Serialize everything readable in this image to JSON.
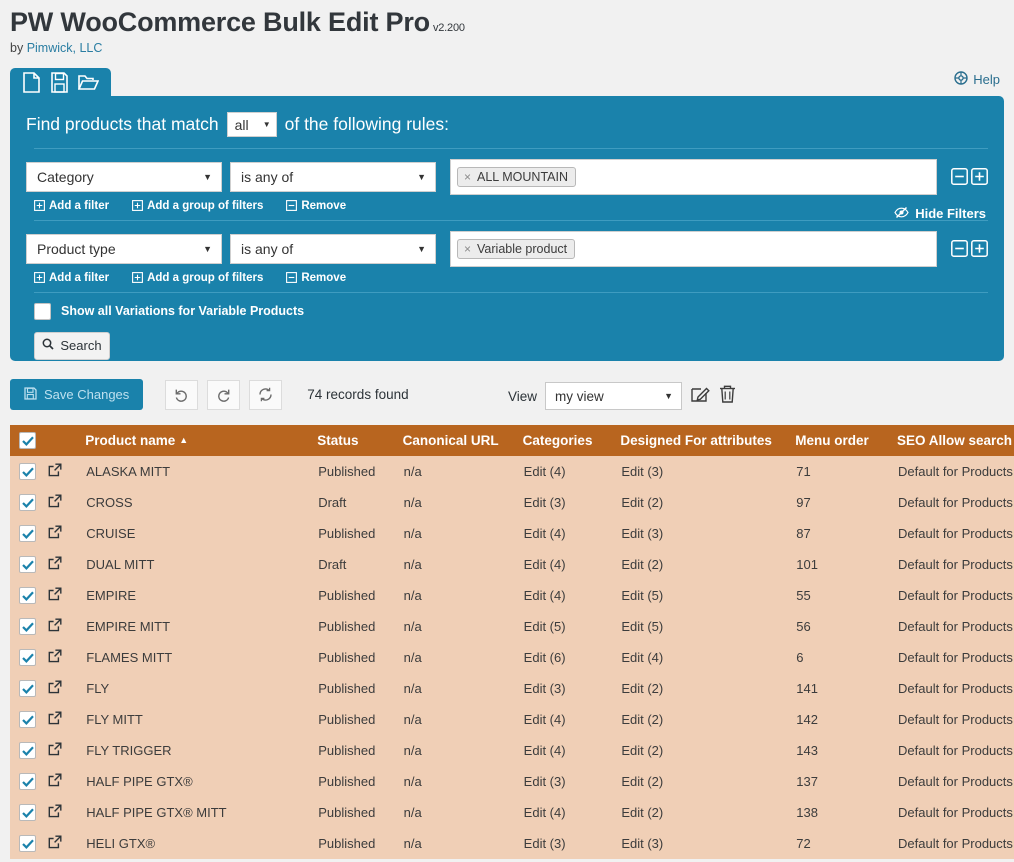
{
  "header": {
    "title": "PW WooCommerce Bulk Edit Pro",
    "version": "v2.200",
    "byline_prefix": "by ",
    "byline_link": "Pimwick, LLC",
    "help_label": "Help"
  },
  "tabs": {
    "new_label": "new-file-icon",
    "save_label": "save-disk-icon",
    "open_label": "open-folder-icon"
  },
  "filters": {
    "heading_prefix": "Find products that match",
    "match_value": "all",
    "heading_suffix": "of the following rules:",
    "hide_filters_label": "Hide Filters",
    "rows": [
      {
        "field": "Category",
        "operator": "is any of",
        "chip": "ALL MOUNTAIN",
        "add_filter": "Add a filter",
        "add_group": "Add a group of filters",
        "remove": "Remove"
      },
      {
        "field": "Product type",
        "operator": "is any of",
        "chip": "Variable product",
        "add_filter": "Add a filter",
        "add_group": "Add a group of filters",
        "remove": "Remove"
      }
    ],
    "show_variations_label": "Show all Variations for Variable Products",
    "show_variations_checked": false,
    "search_label": "Search"
  },
  "toolbar": {
    "save_label": "Save Changes",
    "undo_label": "undo-icon",
    "redo_label": "redo-icon",
    "refresh_label": "refresh-icon",
    "records_found": "74 records found",
    "view_label": "View",
    "view_value": "my view"
  },
  "table": {
    "columns": [
      "Product name",
      "Status",
      "Canonical URL",
      "Categories",
      "Designed For attributes",
      "Menu order",
      "SEO Allow search eng"
    ],
    "sort_column": "Product name",
    "sort_direction": "asc",
    "select_all_checked": true,
    "rows": [
      {
        "checked": true,
        "name": "ALASKA MITT",
        "status": "Published",
        "url": "n/a",
        "categories": "Edit (4)",
        "attributes": "Edit (3)",
        "menu_order": "71",
        "seo": "Default for Products"
      },
      {
        "checked": true,
        "name": "CROSS",
        "status": "Draft",
        "url": "n/a",
        "categories": "Edit (3)",
        "attributes": "Edit (2)",
        "menu_order": "97",
        "seo": "Default for Products"
      },
      {
        "checked": true,
        "name": "CRUISE",
        "status": "Published",
        "url": "n/a",
        "categories": "Edit (4)",
        "attributes": "Edit (3)",
        "menu_order": "87",
        "seo": "Default for Products"
      },
      {
        "checked": true,
        "name": "DUAL MITT",
        "status": "Draft",
        "url": "n/a",
        "categories": "Edit (4)",
        "attributes": "Edit (2)",
        "menu_order": "101",
        "seo": "Default for Products"
      },
      {
        "checked": true,
        "name": "EMPIRE",
        "status": "Published",
        "url": "n/a",
        "categories": "Edit (4)",
        "attributes": "Edit (5)",
        "menu_order": "55",
        "seo": "Default for Products"
      },
      {
        "checked": true,
        "name": "EMPIRE MITT",
        "status": "Published",
        "url": "n/a",
        "categories": "Edit (5)",
        "attributes": "Edit (5)",
        "menu_order": "56",
        "seo": "Default for Products"
      },
      {
        "checked": true,
        "name": "FLAMES MITT",
        "status": "Published",
        "url": "n/a",
        "categories": "Edit (6)",
        "attributes": "Edit (4)",
        "menu_order": "6",
        "seo": "Default for Products"
      },
      {
        "checked": true,
        "name": "FLY",
        "status": "Published",
        "url": "n/a",
        "categories": "Edit (3)",
        "attributes": "Edit (2)",
        "menu_order": "141",
        "seo": "Default for Products"
      },
      {
        "checked": true,
        "name": "FLY MITT",
        "status": "Published",
        "url": "n/a",
        "categories": "Edit (4)",
        "attributes": "Edit (2)",
        "menu_order": "142",
        "seo": "Default for Products"
      },
      {
        "checked": true,
        "name": "FLY TRIGGER",
        "status": "Published",
        "url": "n/a",
        "categories": "Edit (4)",
        "attributes": "Edit (2)",
        "menu_order": "143",
        "seo": "Default for Products"
      },
      {
        "checked": true,
        "name": "HALF PIPE GTX®",
        "status": "Published",
        "url": "n/a",
        "categories": "Edit (3)",
        "attributes": "Edit (2)",
        "menu_order": "137",
        "seo": "Default for Products"
      },
      {
        "checked": true,
        "name": "HALF PIPE GTX® MITT",
        "status": "Published",
        "url": "n/a",
        "categories": "Edit (4)",
        "attributes": "Edit (2)",
        "menu_order": "138",
        "seo": "Default for Products"
      },
      {
        "checked": true,
        "name": "HELI GTX®",
        "status": "Published",
        "url": "n/a",
        "categories": "Edit (3)",
        "attributes": "Edit (3)",
        "menu_order": "72",
        "seo": "Default for Products"
      }
    ]
  },
  "colors": {
    "accent_blue": "#1a82ab",
    "table_header": "#b8651f",
    "table_row": "#f0cfb6",
    "page_background": "#f1f1f1",
    "link": "#2a7da2"
  }
}
